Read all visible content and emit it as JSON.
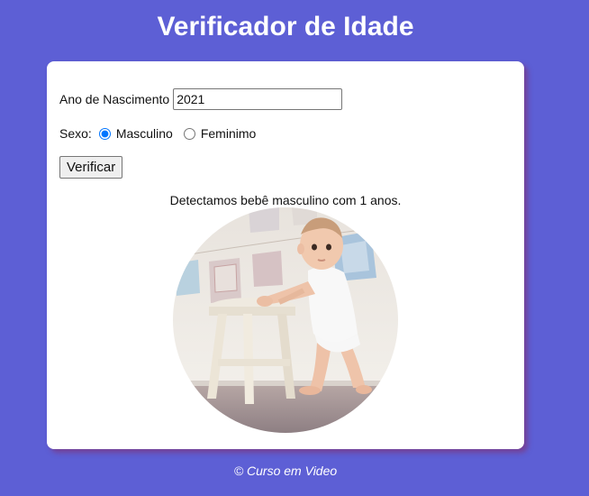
{
  "header": {
    "title": "Verificador de Idade"
  },
  "form": {
    "year_label": "Ano de Nascimento",
    "year_value": "2021",
    "sex_label": "Sexo:",
    "options": [
      {
        "label": "Masculino",
        "selected": true
      },
      {
        "label": "Feminimo",
        "selected": false
      }
    ],
    "submit_label": "Verificar"
  },
  "result": {
    "message": "Detectamos bebê masculino com 1 anos.",
    "image": "baby-boy-standing-by-stool-photo"
  },
  "footer": {
    "text": "© Curso em Video"
  },
  "colors": {
    "background": "#5d5fd5",
    "card": "#ffffff",
    "radio_accent": "#0075ff"
  }
}
